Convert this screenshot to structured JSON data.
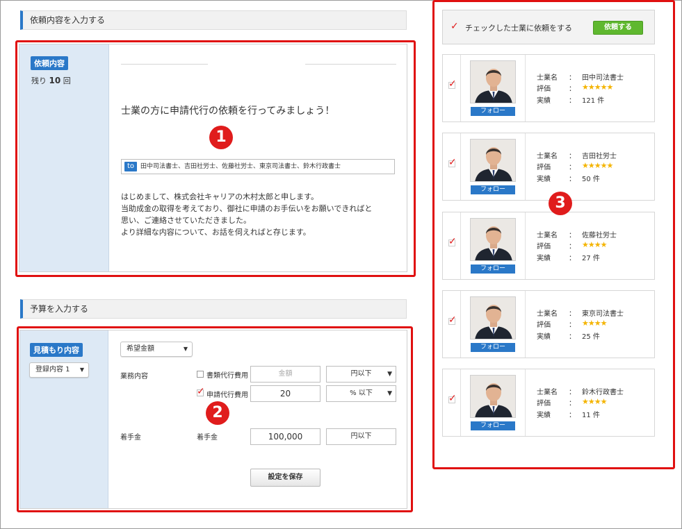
{
  "request_section": {
    "heading": "依頼内容を入力する",
    "side_tag": "依頼内容",
    "remaining_prefix": "残り",
    "remaining_count": "10",
    "remaining_suffix": "回",
    "prompt": "士業の方に申請代行の依頼を行ってみましょう！",
    "to_tag": "to",
    "to_recipients": "田中司法書士、吉田社労士、佐藤社労士、東京司法書士、鈴木行政書士",
    "message_lines": [
      "はじめまして、株式会社キャリアの木村太郎と申します。",
      "当助成金の取得を考えており、御社に申請のお手伝いをお願いできればと",
      "思い、ご連絡させていただきました。",
      "より詳細な内容について、お話を伺えればと存じます。"
    ]
  },
  "budget_section": {
    "heading": "予算を入力する",
    "side_tag": "見積もり内容",
    "template_select": "登録内容 1",
    "amount_select": "希望金額",
    "service_label": "業務内容",
    "rows": [
      {
        "checkbox_label": "書類代行費用",
        "checked": false,
        "value": "",
        "placeholder": "金額",
        "unit": "円以下"
      },
      {
        "checkbox_label": "申請代行費用",
        "checked": true,
        "value": "20",
        "placeholder": "",
        "unit": "% 以下"
      }
    ],
    "deposit_label": "着手金",
    "deposit_sub_label": "着手金",
    "deposit_value": "100,000",
    "deposit_unit": "円以下",
    "save_button": "設定を保存"
  },
  "experts": {
    "request_label": "チェックした士業に依頼をする",
    "request_button": "依頼する",
    "field_labels": {
      "name": "士業名",
      "rating": "評価",
      "record": "実績",
      "colon": "："
    },
    "follow_label": "フォロー",
    "list": [
      {
        "name": "田中司法書士",
        "stars": "★★★★★",
        "rating": 5,
        "record": "121 件",
        "checked": true
      },
      {
        "name": "吉田社労士",
        "stars": "★★★★★",
        "rating": 5,
        "record": "50 件",
        "checked": true
      },
      {
        "name": "佐藤社労士",
        "stars": "★★★★",
        "rating": 4,
        "record": "27 件",
        "checked": true
      },
      {
        "name": "東京司法書士",
        "stars": "★★★★",
        "rating": 4,
        "record": "25 件",
        "checked": true
      },
      {
        "name": "鈴木行政書士",
        "stars": "★★★★",
        "rating": 4,
        "record": "11 件",
        "checked": true
      }
    ]
  },
  "markers": [
    "1",
    "2",
    "3"
  ],
  "colors": {
    "accent_blue": "#2a78c8",
    "highlight_red": "#e01010",
    "star_gold": "#f4b400",
    "button_green": "#5fb82f",
    "side_panel": "#dde9f5"
  }
}
